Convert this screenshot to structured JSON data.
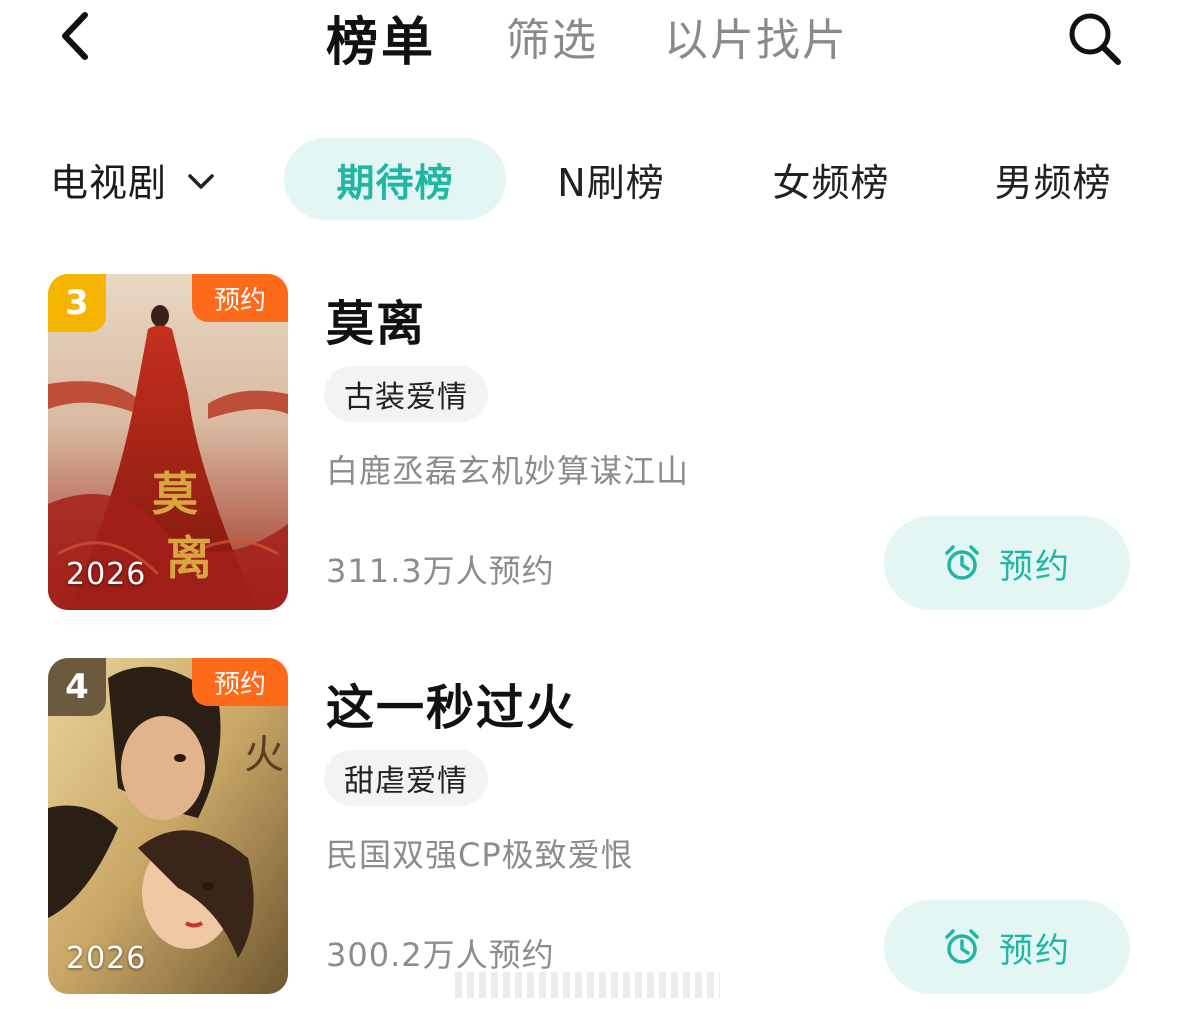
{
  "header": {
    "back_icon": "chevron-left-icon",
    "tabs": [
      {
        "label": "榜单",
        "active": true
      },
      {
        "label": "筛选",
        "active": false
      },
      {
        "label": "以片找片",
        "active": false
      }
    ],
    "search_icon": "search-icon"
  },
  "category": {
    "selected": "电视剧",
    "chevron_icon": "chevron-down-icon"
  },
  "rank_tabs": [
    {
      "label": "期待榜",
      "active": true
    },
    {
      "label": "N刷榜",
      "active": false
    },
    {
      "label": "女频榜",
      "active": false
    },
    {
      "label": "男频榜",
      "active": false
    }
  ],
  "items": [
    {
      "rank": "3",
      "rank_color": "#f5b400",
      "reserve_tag": "预约",
      "year": "2026",
      "title": "莫离",
      "genre": "古装爱情",
      "description": "白鹿丞磊玄机妙算谋江山",
      "count": "311.3万人预约",
      "button_label": "预约",
      "button_icon": "alarm-clock-icon"
    },
    {
      "rank": "4",
      "rank_color": "#6b5a3e",
      "reserve_tag": "预约",
      "year": "2026",
      "title": "这一秒过火",
      "genre": "甜虐爱情",
      "description": "民国双强CP极致爱恨",
      "count": "300.2万人预约",
      "button_label": "预约",
      "button_icon": "alarm-clock-icon"
    }
  ],
  "colors": {
    "accent": "#20b6a4",
    "accent_bg": "#e4f6f3",
    "reserve_tag": "#ff6a1a"
  }
}
